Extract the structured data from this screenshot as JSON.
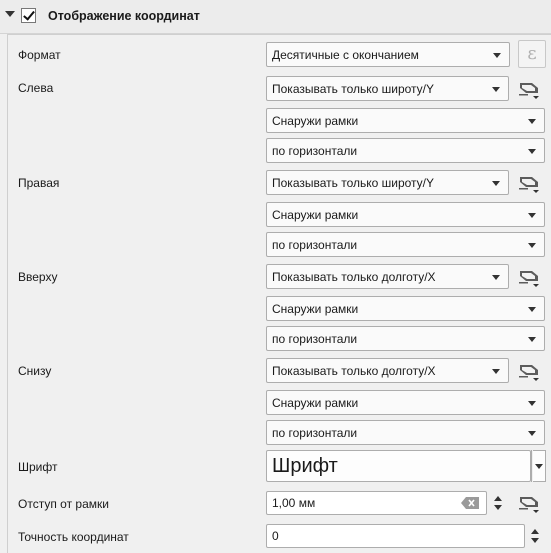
{
  "section": {
    "title": "Отображение координат",
    "enabled": true
  },
  "rows": {
    "format": {
      "label": "Формат",
      "value": "Десятичные с окончанием",
      "expr_icon": "epsilon-icon"
    },
    "left": {
      "label": "Слева",
      "display": "Показывать только широту/Y",
      "position": "Снаружи рамки",
      "direction": "по горизонтали"
    },
    "right": {
      "label": "Правая",
      "display": "Показывать только широту/Y",
      "position": "Снаружи рамки",
      "direction": "по горизонтали"
    },
    "top": {
      "label": "Вверху",
      "display": "Показывать только долготу/X",
      "position": "Снаружи рамки",
      "direction": "по горизонтали"
    },
    "bottom": {
      "label": "Снизу",
      "display": "Показывать только долготу/X",
      "position": "Снаружи рамки",
      "direction": "по горизонтали"
    },
    "font": {
      "label": "Шрифт",
      "button_text": "Шрифт"
    },
    "offset": {
      "label": "Отступ от рамки",
      "value": "1,00 мм"
    },
    "precision": {
      "label": "Точность координат",
      "value": "0"
    }
  },
  "icons": [
    "collapse-arrow-icon",
    "checkbox-checked-icon",
    "data-defined-override-icon",
    "clear-icon",
    "spin-arrows-icon"
  ]
}
